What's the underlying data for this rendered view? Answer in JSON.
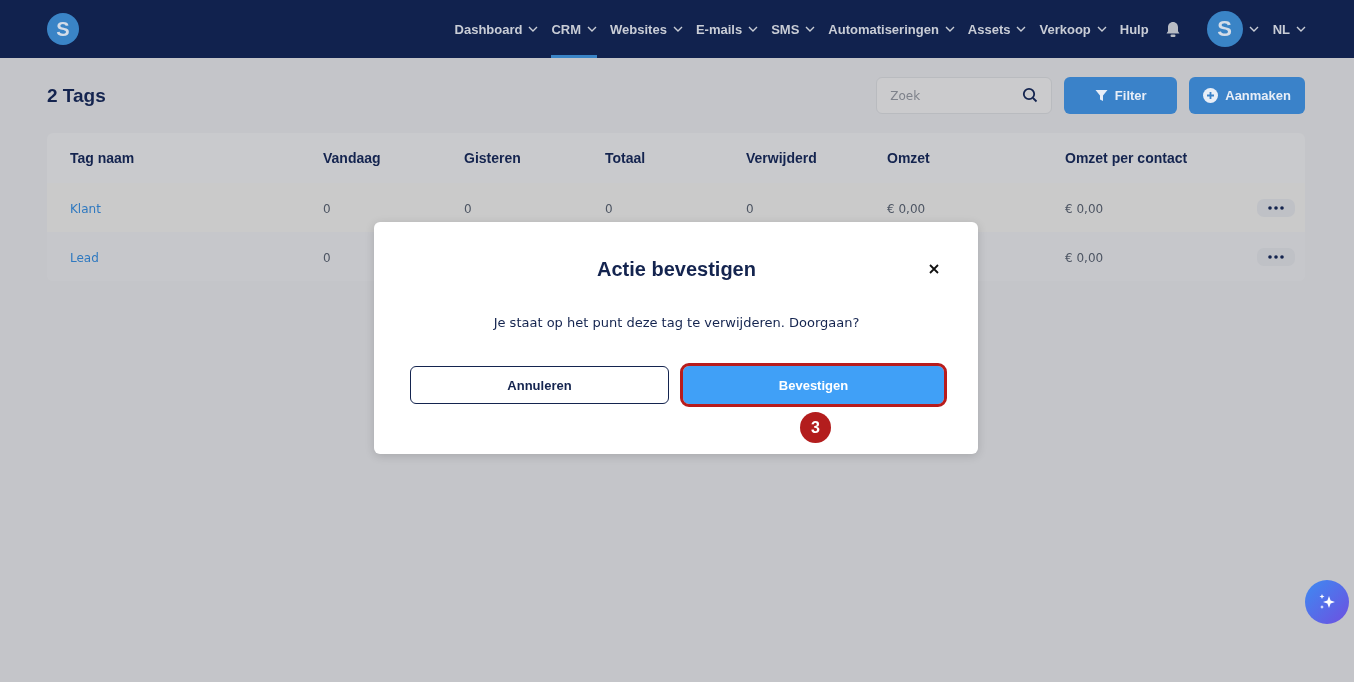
{
  "nav": {
    "items": [
      {
        "label": "Dashboard",
        "dropdown": true,
        "selected": false
      },
      {
        "label": "CRM",
        "dropdown": true,
        "selected": true
      },
      {
        "label": "Websites",
        "dropdown": true,
        "selected": false
      },
      {
        "label": "E-mails",
        "dropdown": true,
        "selected": false
      },
      {
        "label": "SMS",
        "dropdown": true,
        "selected": false
      },
      {
        "label": "Automatiseringen",
        "dropdown": true,
        "selected": false
      },
      {
        "label": "Assets",
        "dropdown": true,
        "selected": false
      },
      {
        "label": "Verkoop",
        "dropdown": true,
        "selected": false
      },
      {
        "label": "Hulp",
        "dropdown": false,
        "selected": false
      }
    ],
    "avatar": "S",
    "language": "NL",
    "logo": "S"
  },
  "page": {
    "title": "2 Tags",
    "search": {
      "placeholder": "Zoek"
    },
    "buttons": [
      "Filter",
      "Aanmaken"
    ]
  },
  "table": {
    "columns": [
      "Tag naam",
      "Vandaag",
      "Gisteren",
      "Totaal",
      "Verwijderd",
      "Omzet",
      "Omzet per contact"
    ],
    "rows": [
      {
        "cells": [
          "Klant",
          "0",
          "0",
          "0",
          "0",
          "€ 0,00",
          "€ 0,00"
        ]
      },
      {
        "cells": [
          "Lead",
          "0",
          null,
          null,
          null,
          null,
          "€ 0,00"
        ]
      }
    ]
  },
  "dialog": {
    "title": "Actie bevestigen",
    "message": "Je staat op het punt deze tag te verwijderen. Doorgaan?",
    "cancel": "Annuleren",
    "confirm": "Bevestigen",
    "confirm_highlighted": true,
    "step_marker": "3"
  }
}
